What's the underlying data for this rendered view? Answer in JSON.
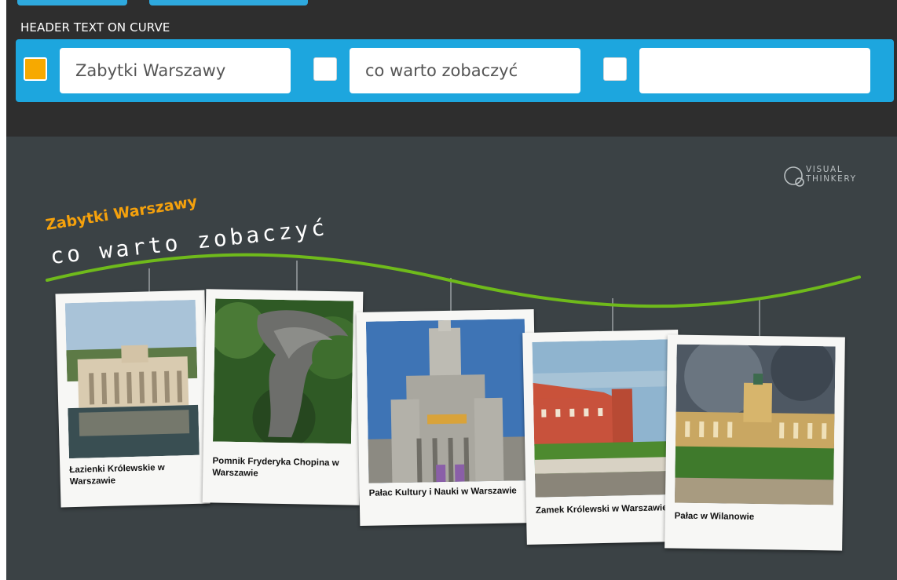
{
  "panel": {
    "title": "HEADER TEXT ON CURVE",
    "lines": [
      {
        "checked": true,
        "value": "Zabytki Warszawy"
      },
      {
        "checked": false,
        "value": "co warto zobaczyć"
      },
      {
        "checked": false,
        "value": ""
      }
    ]
  },
  "canvas": {
    "logo": {
      "line1": "VISUAL",
      "line2": "THINKERY"
    },
    "title_line1": "Zabytki Warszawy",
    "title_line2": "co warto zobaczyć",
    "photos": [
      {
        "caption": "Łazienki Królewskie w Warszawie"
      },
      {
        "caption": "Pomnik Fryderyka Chopina w Warszawie"
      },
      {
        "caption": "Pałac Kultury i Nauki w Warszawie"
      },
      {
        "caption": "Zamek Królewski w Warszawie"
      },
      {
        "caption": "Pałac w Wilanowie"
      }
    ]
  },
  "colors": {
    "accent": "#1da6de",
    "checkbox_checked": "#f7a900",
    "curve": "#6fba1b",
    "canvas_bg": "#3b4245",
    "title_orange": "#f5a10c"
  }
}
